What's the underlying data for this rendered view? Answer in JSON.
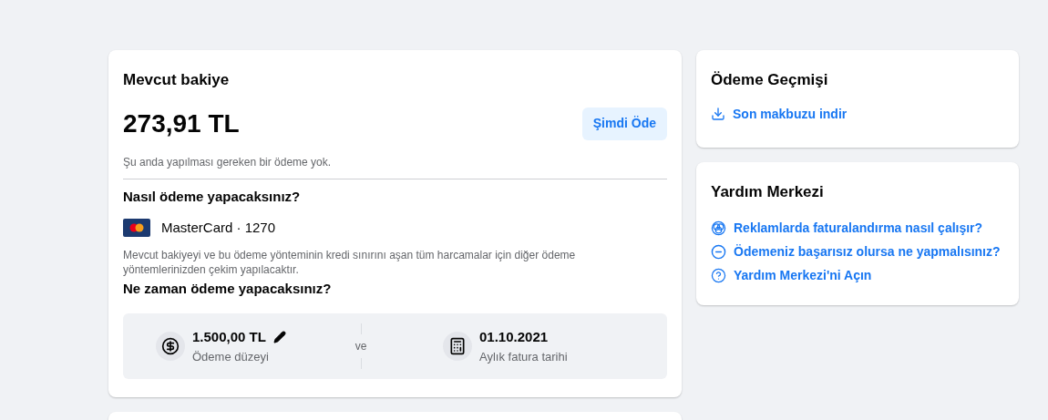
{
  "balance_card": {
    "title": "Mevcut bakiye",
    "amount": "273,91 TL",
    "pay_button": "Şimdi Öde",
    "note": "Şu anda yapılması gereken bir ödeme yok.",
    "method_heading": "Nasıl ödeme yapacaksınız?",
    "card_label": "MasterCard · 1270",
    "method_note": "Mevcut bakiyeyi ve bu ödeme yönteminin kredi sınırını aşan tüm harcamalar için diğer ödeme yöntemlerinizden çekim yapılacaktır.",
    "when_heading": "Ne zaman ödeme yapacaksınız?",
    "threshold": {
      "value": "1.500,00 TL",
      "label": "Ödeme düzeyi"
    },
    "connector": "ve",
    "bill_date": {
      "value": "01.10.2021",
      "label": "Aylık fatura tarihi"
    }
  },
  "history_card": {
    "title": "Ödeme Geçmişi",
    "link": "Son makbuzu indir"
  },
  "help_card": {
    "title": "Yardım Merkezi",
    "links": [
      {
        "kind": "venn",
        "text": "Reklamlarda faturalandırma nasıl çalışır?"
      },
      {
        "kind": "minus",
        "text": "Ödemeniz başarısız olursa ne yapmalısınız?"
      },
      {
        "kind": "help",
        "text": "Yardım Merkezi'ni Açın"
      }
    ]
  }
}
